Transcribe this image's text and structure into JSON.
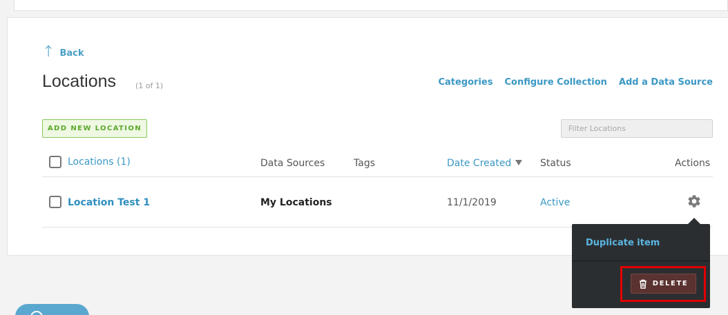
{
  "nav": {
    "back_label": "Back",
    "back_icon": "arrow-up-icon"
  },
  "page": {
    "title": "Locations",
    "count": "(1 of 1)"
  },
  "header_links": [
    "Categories",
    "Configure Collection",
    "Add a Data Source"
  ],
  "toolbar": {
    "add_label": "ADD NEW LOCATION",
    "filter_placeholder": "Filter Locations",
    "filter_value": ""
  },
  "table": {
    "columns": {
      "name": "Locations (1)",
      "data_sources": "Data Sources",
      "tags": "Tags",
      "date_created": "Date Created",
      "status": "Status",
      "actions": "Actions"
    },
    "sort": {
      "column": "date_created",
      "direction": "descending"
    },
    "rows": [
      {
        "name": "Location Test 1",
        "data_sources": "My Locations",
        "tags": "",
        "date_created": "11/1/2019",
        "status": "Active",
        "checked": false
      }
    ]
  },
  "actions_menu": {
    "open": true,
    "duplicate_label": "Duplicate item",
    "delete_label": "DELETE",
    "delete_icon": "trash-icon",
    "highlighted_item": "DELETE"
  },
  "colors": {
    "link": "#3b98c4",
    "add_button_border": "#8ac85a",
    "menu_background": "#2b2e31",
    "delete_background": "#5a3230",
    "highlight": "#e10000",
    "help_button": "#5aa7cf"
  }
}
